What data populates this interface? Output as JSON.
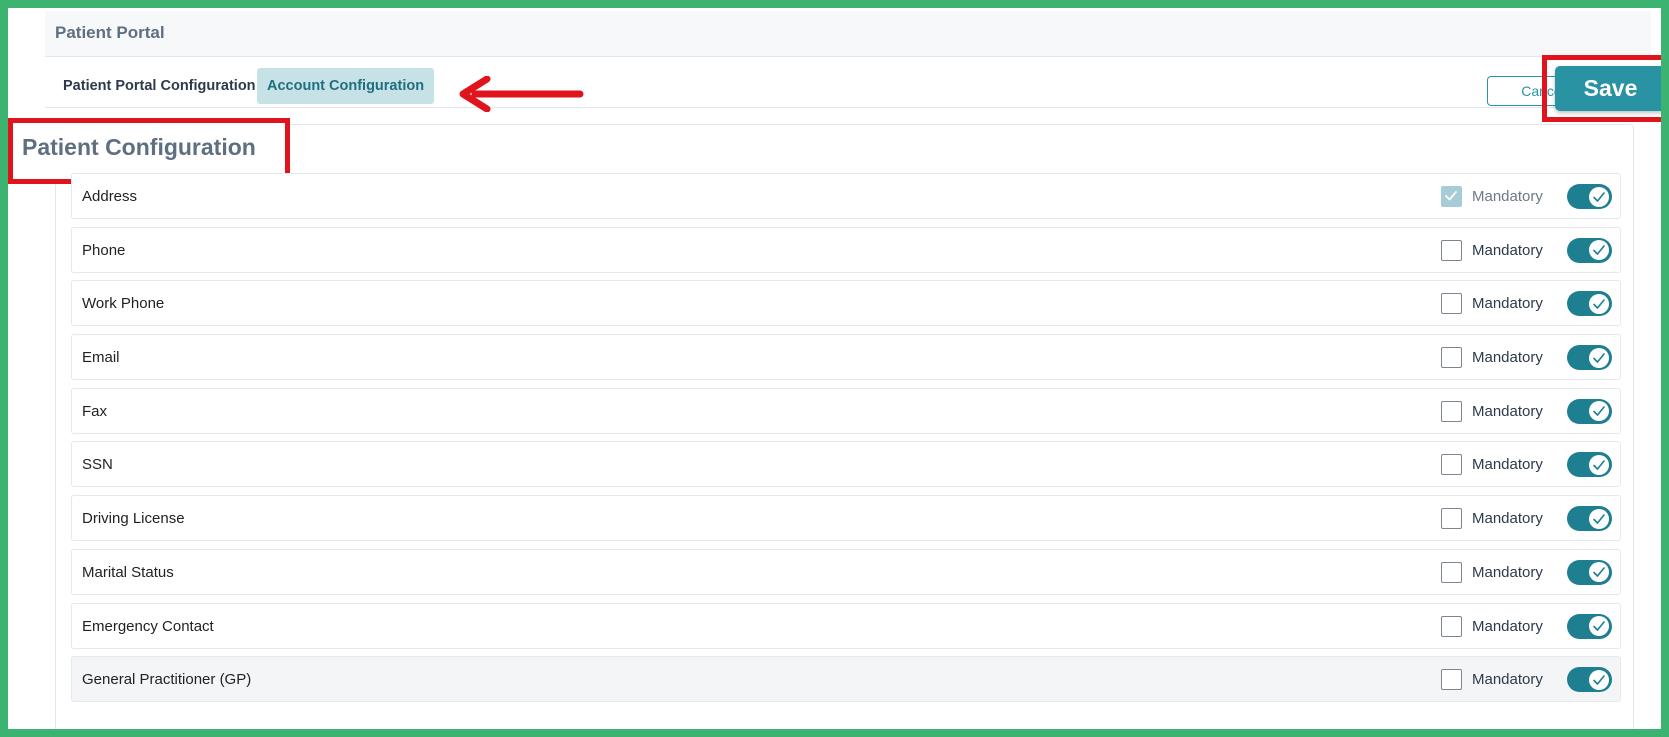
{
  "header": {
    "title": "Patient Portal"
  },
  "tabs": [
    {
      "label": "Patient Portal Configuration",
      "active": false
    },
    {
      "label": "Account Configuration",
      "active": true
    }
  ],
  "actions": {
    "cancel_label": "Cancel",
    "save_label": "Save"
  },
  "section": {
    "title": "Patient Configuration"
  },
  "mandatory_label": "Mandatory",
  "rows": [
    {
      "label": "Address",
      "mandatory_checked": true,
      "mandatory_disabled": true,
      "enabled": true
    },
    {
      "label": "Phone",
      "mandatory_checked": false,
      "mandatory_disabled": false,
      "enabled": true
    },
    {
      "label": "Work Phone",
      "mandatory_checked": false,
      "mandatory_disabled": false,
      "enabled": true
    },
    {
      "label": "Email",
      "mandatory_checked": false,
      "mandatory_disabled": false,
      "enabled": true
    },
    {
      "label": "Fax",
      "mandatory_checked": false,
      "mandatory_disabled": false,
      "enabled": true
    },
    {
      "label": "SSN",
      "mandatory_checked": false,
      "mandatory_disabled": false,
      "enabled": true
    },
    {
      "label": "Driving License",
      "mandatory_checked": false,
      "mandatory_disabled": false,
      "enabled": true
    },
    {
      "label": "Marital Status",
      "mandatory_checked": false,
      "mandatory_disabled": false,
      "enabled": true
    },
    {
      "label": "Emergency Contact",
      "mandatory_checked": false,
      "mandatory_disabled": false,
      "enabled": true
    },
    {
      "label": "General Practitioner (GP)",
      "mandatory_checked": false,
      "mandatory_disabled": false,
      "enabled": true
    }
  ],
  "colors": {
    "accent": "#2a93a3",
    "toggle_on": "#1e7f91",
    "annotation": "#e0141c",
    "outer_border": "#3cb371"
  }
}
